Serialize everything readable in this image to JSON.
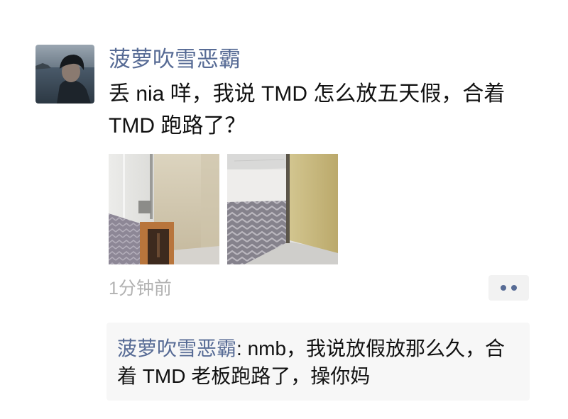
{
  "post": {
    "author": "菠萝吹雪恶霸",
    "avatar_icon": "user-avatar-photo",
    "text": "丢 nia 咩，我说 TMD 怎么放五天假，合着 TMD 跑路了？",
    "images": [
      {
        "icon": "office-glass-door-photo"
      },
      {
        "icon": "empty-office-photo"
      }
    ],
    "timestamp": "1分钟前",
    "more_button": {
      "icon": "more-dots-icon"
    }
  },
  "comments": [
    {
      "author": "菠萝吹雪恶霸",
      "separator": ": ",
      "text": "nmb，我说放假放那么久，合着 TMD 老板跑路了，操你妈"
    }
  ],
  "colors": {
    "link": "#576b95",
    "text": "#111111",
    "muted": "#b2b2b2",
    "comment_panel": "#f7f7f7",
    "more_button_bg": "#f2f2f2"
  }
}
